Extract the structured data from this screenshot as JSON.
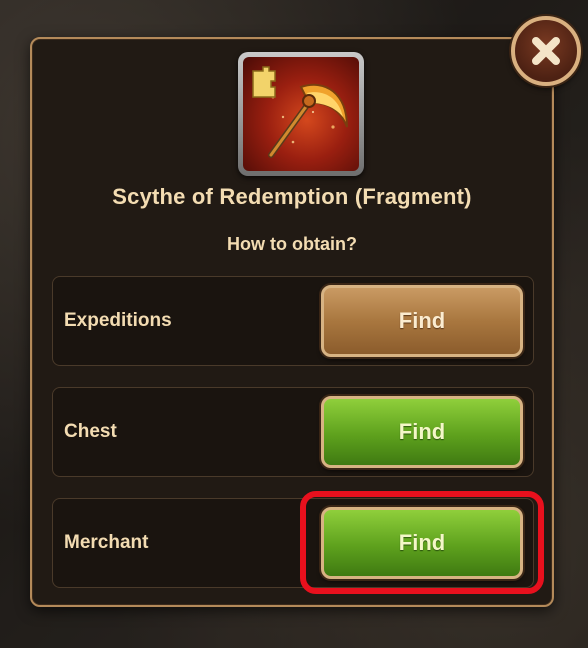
{
  "dialog": {
    "item_name": "Scythe of Redemption (Fragment)",
    "obtain_prompt": "How to obtain?",
    "item_icon": "scythe-fragment-icon",
    "close_icon": "close-icon"
  },
  "sources": [
    {
      "label": "Expeditions",
      "button": "Find",
      "button_style": "tan"
    },
    {
      "label": "Chest",
      "button": "Find",
      "button_style": "green"
    },
    {
      "label": "Merchant",
      "button": "Find",
      "button_style": "green",
      "highlighted": true
    }
  ],
  "colors": {
    "panel_bg": "#211a14",
    "panel_border": "#b48a5a",
    "text": "#f3dcb2",
    "button_tan": "#a9773f",
    "button_green": "#5ea11d",
    "highlight": "#e8101d"
  }
}
